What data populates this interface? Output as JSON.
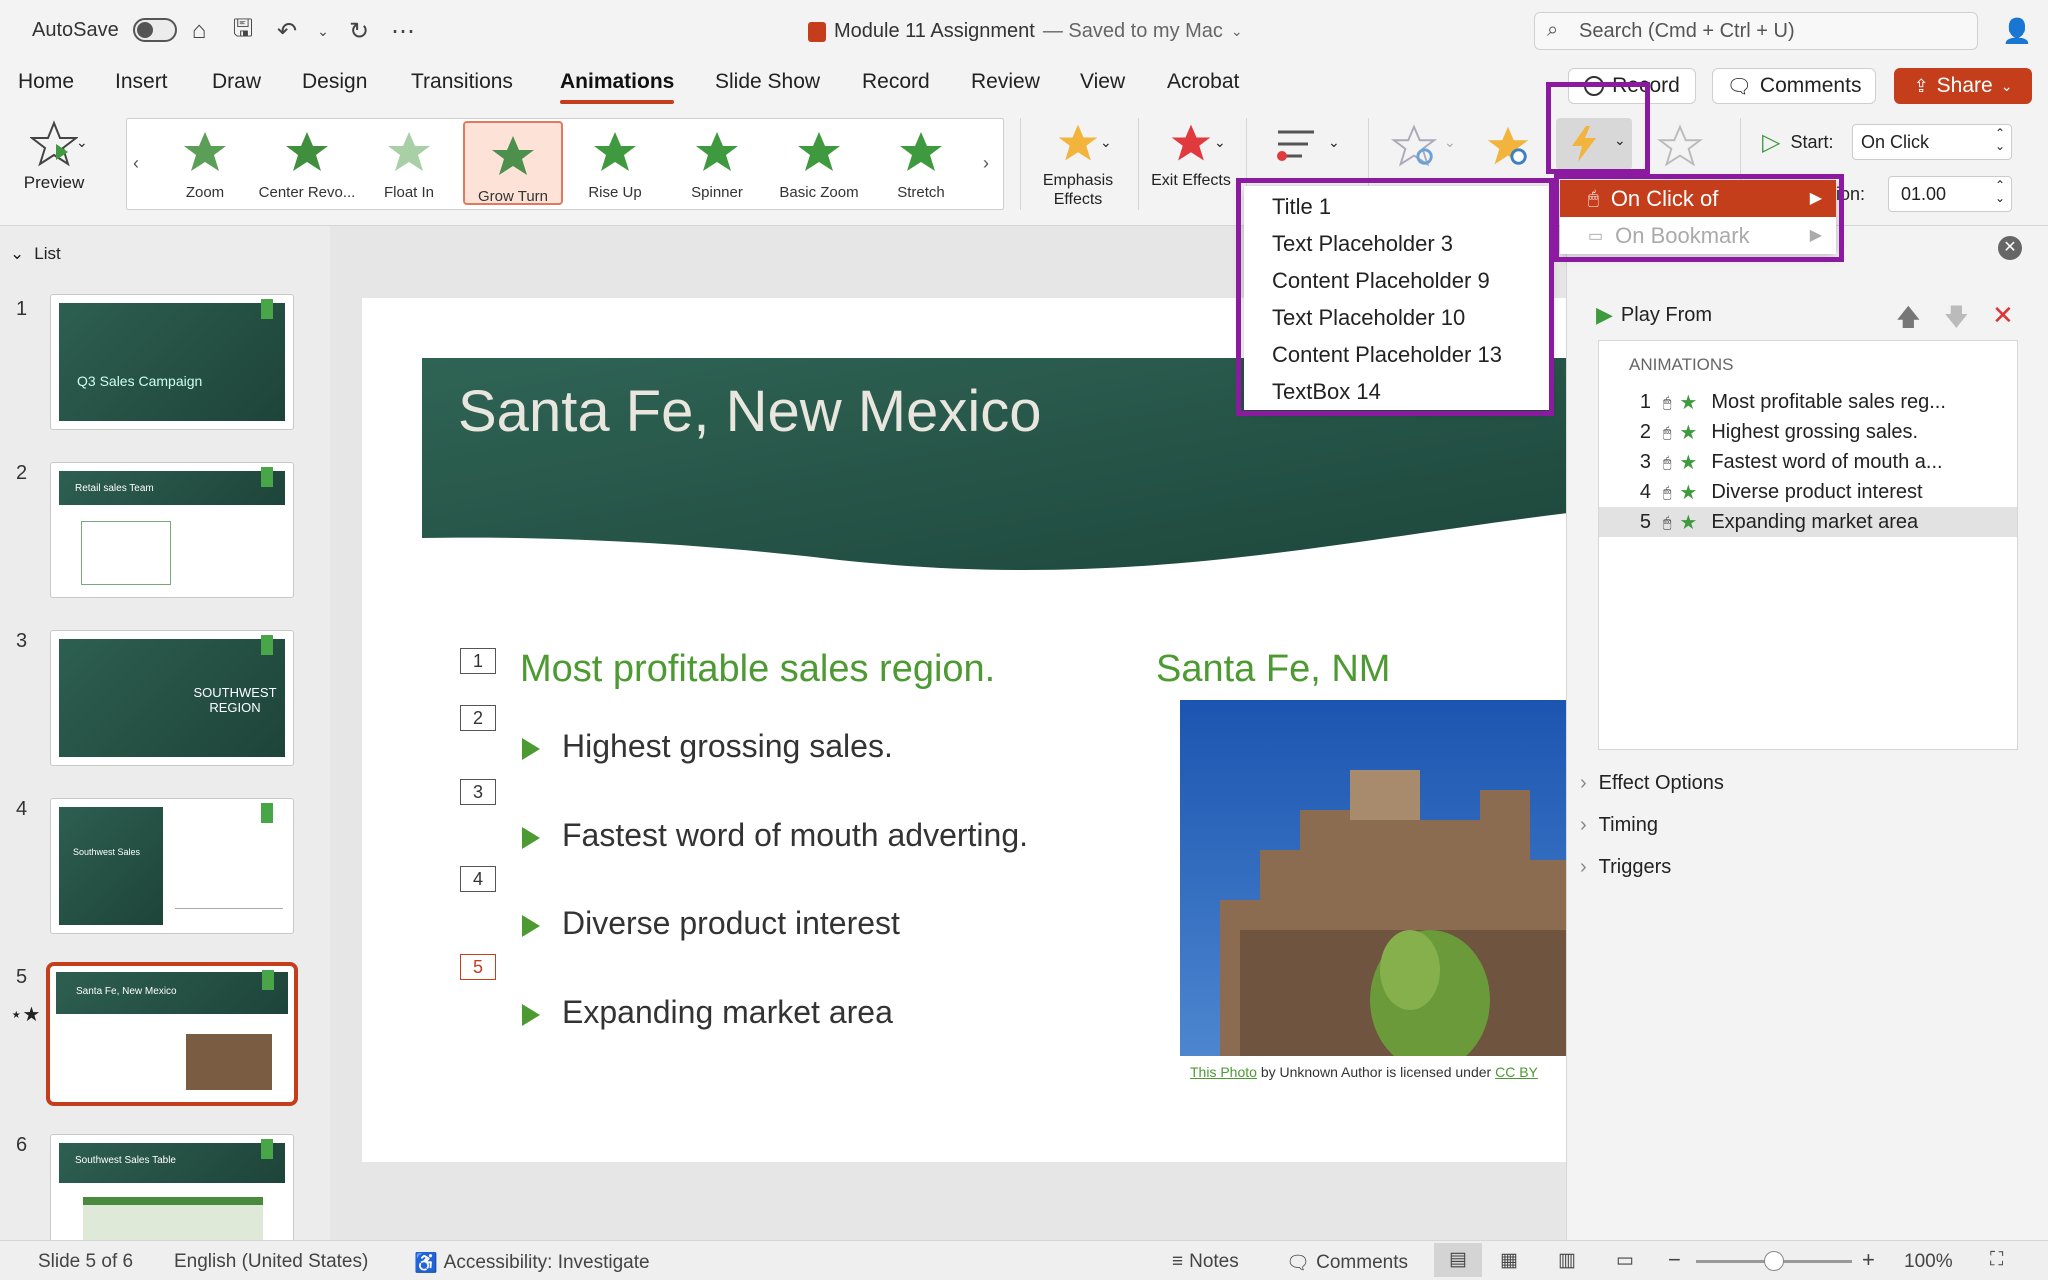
{
  "titlebar": {
    "autosave_label": "AutoSave",
    "doc_title": "Module 11 Assignment",
    "save_status": "— Saved to my Mac",
    "search_placeholder": "Search (Cmd + Ctrl + U)"
  },
  "tabs": [
    "Home",
    "Insert",
    "Draw",
    "Design",
    "Transitions",
    "Animations",
    "Slide Show",
    "Record",
    "Review",
    "View",
    "Acrobat"
  ],
  "active_tab": "Animations",
  "top_buttons": {
    "record": "Record",
    "comments": "Comments",
    "share": "Share"
  },
  "ribbon": {
    "preview": "Preview",
    "gallery": [
      "Zoom",
      "Center Revo...",
      "Float In",
      "Grow Turn",
      "Rise Up",
      "Spinner",
      "Basic Zoom",
      "Stretch"
    ],
    "selected_effect": "Grow Turn",
    "emphasis": "Emphasis Effects",
    "exit": "Exit Effects",
    "start_label": "Start:",
    "start_value": "On Click",
    "duration_label": "ion:",
    "duration_value": "01.00"
  },
  "trigger_menu": {
    "on_click": "On Click of",
    "on_bookmark": "On Bookmark"
  },
  "object_menu": [
    "Title 1",
    "Text Placeholder 3",
    "Content Placeholder 9",
    "Text Placeholder 10",
    "Content Placeholder 13",
    "TextBox 14"
  ],
  "left_panel": {
    "header": "List",
    "slides": [
      {
        "num": "1",
        "title": "Q3 Sales Campaign"
      },
      {
        "num": "2",
        "title": "Retail sales Team"
      },
      {
        "num": "3",
        "title": "SOUTHWEST REGION"
      },
      {
        "num": "4",
        "title": "Southwest Sales"
      },
      {
        "num": "5",
        "title": "Santa Fe, New Mexico"
      },
      {
        "num": "6",
        "title": "Southwest Sales Table"
      }
    ]
  },
  "slide": {
    "title": "Santa Fe, New Mexico",
    "subheading": "Most profitable sales region.",
    "right_heading": "Santa Fe, NM",
    "bullets": [
      "Highest grossing sales.",
      "Fastest word of mouth adverting.",
      "Diverse product interest",
      "Expanding market area"
    ],
    "anim_numbers": [
      "1",
      "2",
      "3",
      "4",
      "5"
    ],
    "caption_link": "This Photo",
    "caption_text": " by Unknown Author is licensed under ",
    "caption_license": "CC BY"
  },
  "animation_pane": {
    "play_from": "Play From",
    "header": "ANIMATIONS",
    "items": [
      {
        "n": "1",
        "label": "Most profitable sales reg..."
      },
      {
        "n": "2",
        "label": "Highest grossing sales."
      },
      {
        "n": "3",
        "label": "Fastest word of mouth a..."
      },
      {
        "n": "4",
        "label": "Diverse product interest"
      },
      {
        "n": "5",
        "label": "Expanding market area"
      }
    ],
    "sections": [
      "Effect Options",
      "Timing",
      "Triggers"
    ]
  },
  "statusbar": {
    "slide_info": "Slide 5 of 6",
    "language": "English (United States)",
    "accessibility": "Accessibility: Investigate",
    "notes": "Notes",
    "comments": "Comments",
    "zoom": "100%"
  },
  "colors": {
    "accent": "#c43e1c",
    "highlight": "#8b1aa0",
    "slide_green": "#2d5f50",
    "text_green": "#4d9a33"
  }
}
